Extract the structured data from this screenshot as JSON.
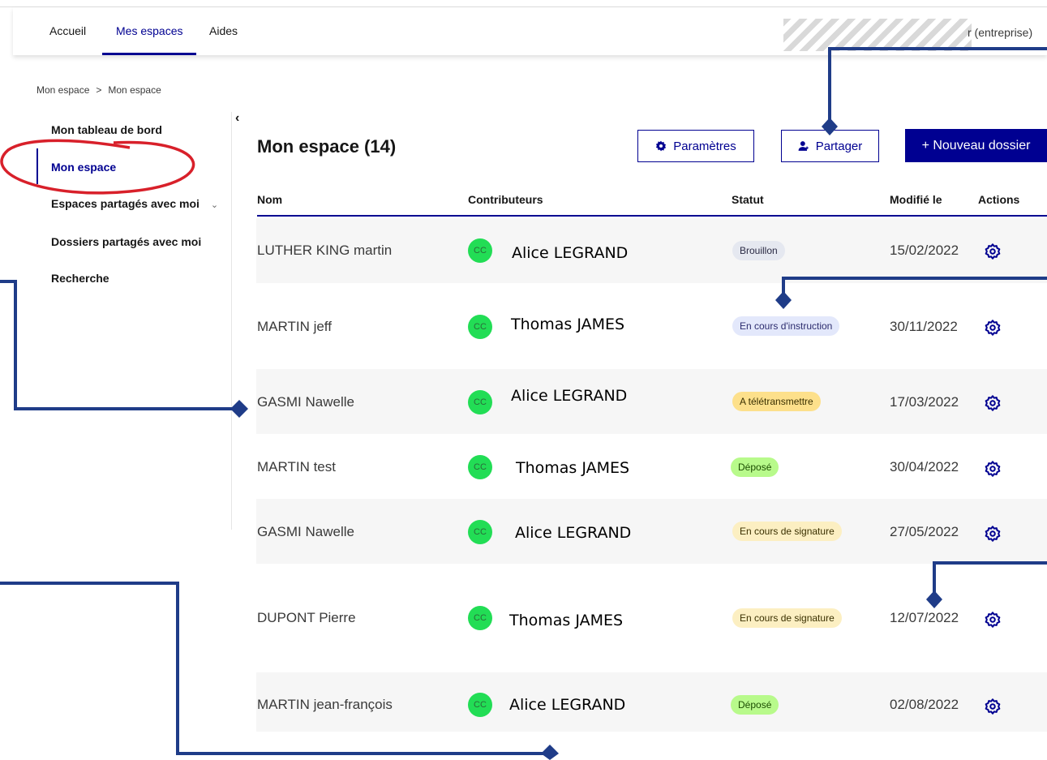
{
  "topnav": {
    "items": [
      {
        "label": "Accueil",
        "active": false
      },
      {
        "label": "Mes espaces",
        "active": true
      },
      {
        "label": "Aides",
        "active": false
      }
    ],
    "user_suffix": "r (entreprise)"
  },
  "breadcrumb": {
    "items": [
      "Mon espace",
      "Mon espace"
    ],
    "separator": ">"
  },
  "sidebar": {
    "collapse_icon": "‹",
    "items": [
      {
        "label": "Mon tableau de bord"
      },
      {
        "label": "Mon espace",
        "active": true
      },
      {
        "label": "Espaces partagés avec moi",
        "chevron": "⌄"
      },
      {
        "label": "Dossiers partagés avec moi"
      },
      {
        "label": "Recherche"
      }
    ]
  },
  "main": {
    "title": "Mon espace (14)",
    "buttons": {
      "settings": "Paramètres",
      "share": "Partager",
      "new_folder": "+ Nouveau dossier"
    },
    "table": {
      "headers": [
        "Nom",
        "Contributeurs",
        "Statut",
        "Modifié le",
        "Actions"
      ],
      "rows": [
        {
          "name": "LUTHER KING martin",
          "initials": "CC",
          "contributor": "Alice LEGRAND",
          "status": "Brouillon",
          "date": "15/02/2022"
        },
        {
          "name": "MARTIN jeff",
          "initials": "CC",
          "contributor": "Thomas JAMES",
          "status": "En cours d'instruction",
          "date": "30/11/2022"
        },
        {
          "name": "GASMI Nawelle",
          "initials": "CC",
          "contributor": "Alice LEGRAND",
          "status": "A télétransmettre",
          "date": "17/03/2022"
        },
        {
          "name": "MARTIN test",
          "initials": "CC",
          "contributor": "Thomas JAMES",
          "status": "Déposé",
          "date": "30/04/2022"
        },
        {
          "name": "GASMI Nawelle",
          "initials": "CC",
          "contributor": "Alice LEGRAND",
          "status": "En cours de signature",
          "date": "27/05/2022"
        },
        {
          "name": "DUPONT Pierre",
          "initials": "CC",
          "contributor": "Thomas JAMES",
          "status": "En cours de signature",
          "date": "12/07/2022"
        },
        {
          "name": "MARTIN jean-françois",
          "initials": "CC",
          "contributor": "Alice LEGRAND",
          "status": "Déposé",
          "date": "02/08/2022"
        }
      ]
    }
  },
  "colors": {
    "brand_blue": "#000091",
    "annotation_blue": "#1f3c88",
    "annotation_red": "#d8202a",
    "avatar_green": "#22dd55"
  },
  "icons": {
    "settings_button": "gear-icon",
    "share_button": "user-add-icon",
    "row_action": "gear-icon"
  }
}
